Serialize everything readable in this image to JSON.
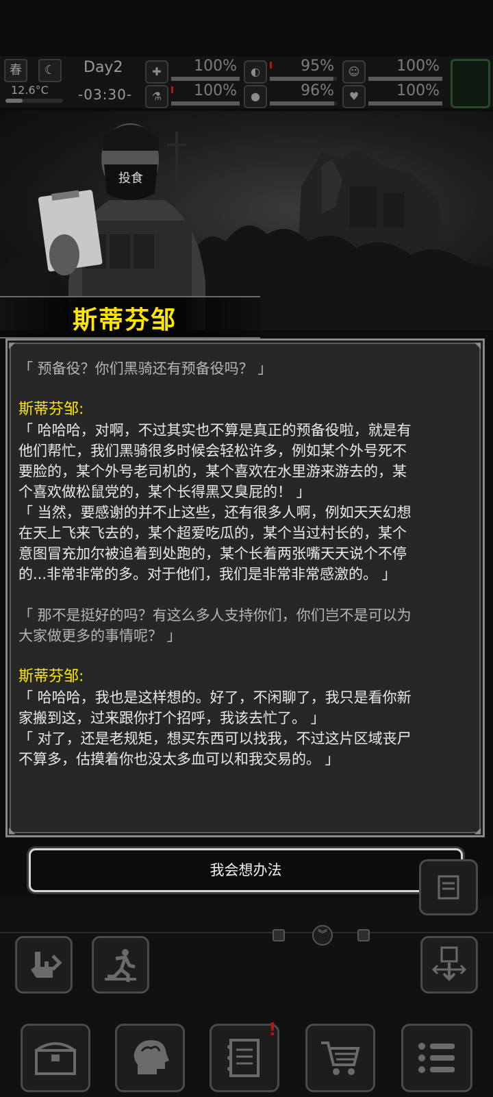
{
  "status": {
    "season": "春",
    "moon_icon": "moon-icon",
    "day": "Day2",
    "time": "-03:30-",
    "temperature": "12.6°C",
    "temperature_level": 0.3,
    "stats": [
      {
        "name": "health",
        "icon": "medkit-icon",
        "value": "100%",
        "level": 1.0
      },
      {
        "name": "hunger",
        "icon": "stomach-icon",
        "value": "95%",
        "level": 0.95
      },
      {
        "name": "mood",
        "icon": "face-icon",
        "value": "100%",
        "level": 1.0
      },
      {
        "name": "infection",
        "icon": "flask-icon",
        "value": "100%",
        "level": 1.0
      },
      {
        "name": "thirst",
        "icon": "water-drop-icon",
        "value": "96%",
        "level": 0.96
      },
      {
        "name": "heart",
        "icon": "heart-icon",
        "value": "100%",
        "level": 1.0
      }
    ]
  },
  "speaker": {
    "name": "斯蒂芬邹"
  },
  "dialog": {
    "q1": "「 预备役？你们黑骑还有预备役吗？ 」",
    "sp1": "斯蒂芬邹:",
    "a1_l1": "「 哈哈哈，对啊，不过其实也不算是真正的预备役啦，就是有",
    "a1_l2": "他们帮忙，我们黑骑很多时候会轻松许多，例如某个外号死不",
    "a1_l3": "要脸的，某个外号老司机的，某个喜欢在水里游来游去的，某",
    "a1_l4": "个喜欢做松鼠党的，某个长得黑又臭屁的！ 」",
    "a2_l1": "「 当然，要感谢的并不止这些，还有很多人啊，例如天天幻想",
    "a2_l2": "在天上飞来飞去的，某个超爱吃瓜的，某个当过村长的，某个",
    "a2_l3": "意图冒充加尔被追着到处跑的，某个长着两张嘴天天说个不停",
    "a2_l4": "的...非常非常的多。对于他们，我们是非常非常感激的。 」",
    "q2_l1": "「 那不是挺好的吗？有这么多人支持你们，你们岂不是可以为",
    "q2_l2": "大家做更多的事情呢？ 」",
    "sp2": "斯蒂芬邹:",
    "a3_l1": "「 哈哈哈，我也是这样想的。好了，不闲聊了，我只是看你新",
    "a3_l2": "家搬到这，过来跟你打个招呼，我该去忙了。 」",
    "a4_l1": "「 对了，还是老规矩，想买东西可以找我，不过这片区域丧尸",
    "a4_l2": "不算多，估摸着你也没太多血可以和我交易的。 」"
  },
  "reply_button": "我会想办法",
  "mask_text": "投食",
  "colors": {
    "speaker": "#ffe600",
    "accent_green": "#274a27",
    "alert_red": "#b31414"
  }
}
